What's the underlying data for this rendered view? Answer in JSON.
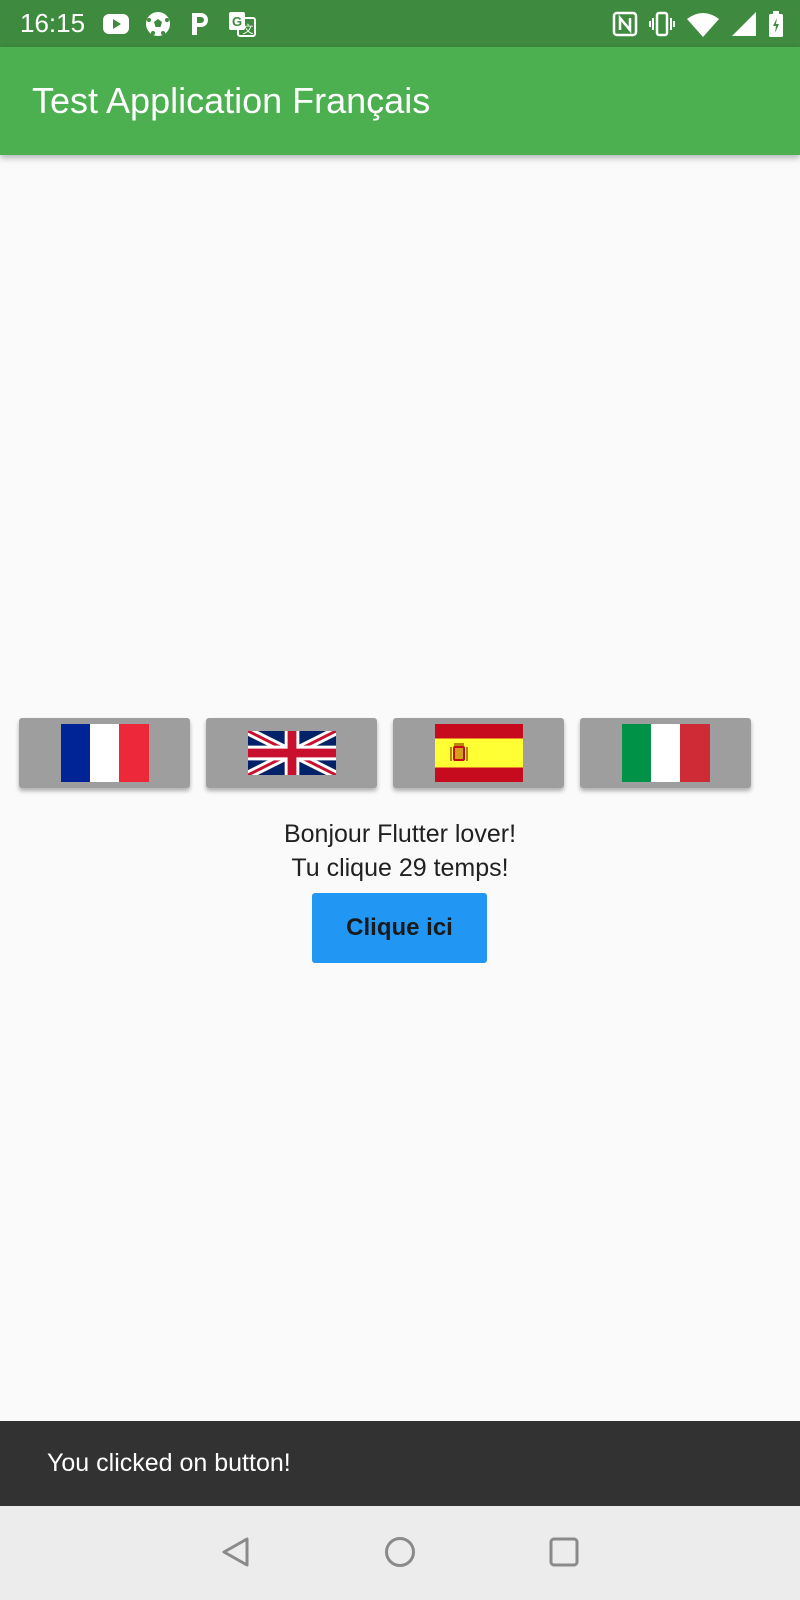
{
  "status_bar": {
    "time": "16:15",
    "left_icons": [
      "youtube-icon",
      "soccer-ball-icon",
      "parking-icon",
      "translate-icon"
    ],
    "right_icons": [
      "nfc-icon",
      "vibrate-icon",
      "wifi-icon",
      "signal-icon",
      "battery-icon"
    ]
  },
  "app_bar": {
    "title": "Test Application Français",
    "color": "#4caf50"
  },
  "flags": [
    {
      "name": "france-flag-icon",
      "language": "fr"
    },
    {
      "name": "uk-flag-icon",
      "language": "en"
    },
    {
      "name": "spain-flag-icon",
      "language": "es"
    },
    {
      "name": "italy-flag-icon",
      "language": "it"
    }
  ],
  "content": {
    "greeting": "Bonjour Flutter lover!",
    "click_count_text": "Tu clique 29 temps!",
    "button_label": "Clique ici",
    "button_color": "#2196f3"
  },
  "snackbar": {
    "message": "You clicked on button!"
  },
  "nav_bar": {
    "buttons": [
      "back-icon",
      "home-icon",
      "recents-icon"
    ]
  }
}
